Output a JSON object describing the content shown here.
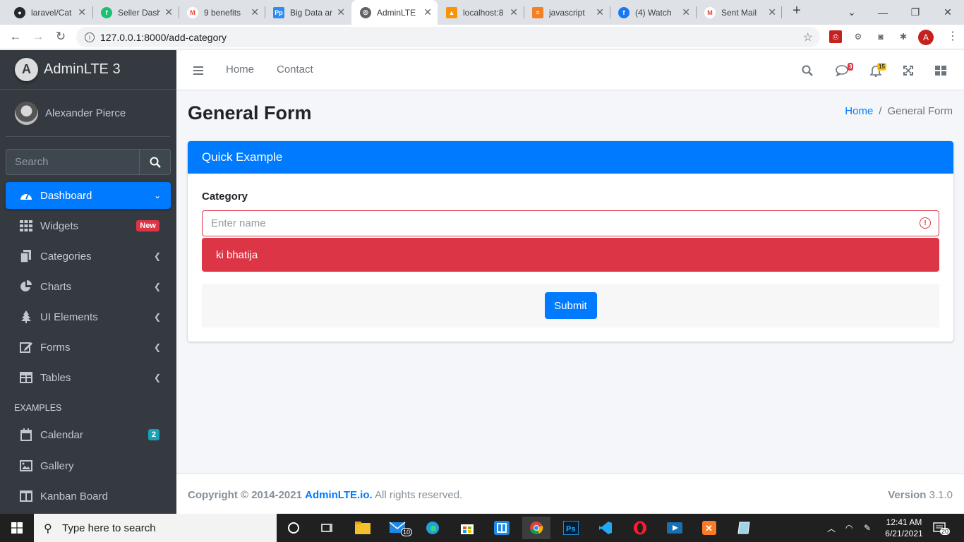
{
  "browser": {
    "tabs": [
      {
        "title": "laravel/Cat",
        "icon": "github-icon",
        "color": "#24292e"
      },
      {
        "title": "Seller Dash",
        "icon": "fiverr-icon",
        "color": "#1dbf73"
      },
      {
        "title": "9 benefits",
        "icon": "gmail-icon",
        "color": "#ea4335"
      },
      {
        "title": "Big Data ar",
        "icon": "pp-icon",
        "color": "#2d8cf0"
      },
      {
        "title": "AdminLTE",
        "icon": "globe-icon",
        "color": "#5f6368"
      },
      {
        "title": "localhost:8",
        "icon": "phpmyadmin-icon",
        "color": "#f89406"
      },
      {
        "title": "javascript",
        "icon": "stackoverflow-icon",
        "color": "#f48024"
      },
      {
        "title": "(4) Watch",
        "icon": "facebook-icon",
        "color": "#1877f2"
      },
      {
        "title": "Sent Mail",
        "icon": "gmail-icon",
        "color": "#ea4335"
      }
    ],
    "url": "127.0.0.1:8000/add-category",
    "profile_initial": "A"
  },
  "sidebar": {
    "brand": "AdminLTE 3",
    "brand_logo": "A",
    "user": "Alexander Pierce",
    "search_placeholder": "Search",
    "items": [
      {
        "label": "Dashboard",
        "icon": "dashboard-icon"
      },
      {
        "label": "Widgets",
        "icon": "widgets-icon",
        "badge": "New"
      },
      {
        "label": "Categories",
        "icon": "copy-icon"
      },
      {
        "label": "Charts",
        "icon": "chart-pie-icon"
      },
      {
        "label": "UI Elements",
        "icon": "tree-icon"
      },
      {
        "label": "Forms",
        "icon": "edit-icon"
      },
      {
        "label": "Tables",
        "icon": "table-icon"
      }
    ],
    "examples_header": "EXAMPLES",
    "examples": [
      {
        "label": "Calendar",
        "icon": "calendar-icon",
        "badge": "2"
      },
      {
        "label": "Gallery",
        "icon": "image-icon"
      },
      {
        "label": "Kanban Board",
        "icon": "columns-icon"
      }
    ]
  },
  "header": {
    "links": [
      "Home",
      "Contact"
    ],
    "messages_count": "3",
    "notifications_count": "15"
  },
  "page": {
    "title": "General Form",
    "breadcrumb": [
      "Home",
      "/",
      "General Form"
    ]
  },
  "card": {
    "title": "Quick Example",
    "label": "Category",
    "placeholder": "Enter name",
    "error": "ki bhatija",
    "submit": "Submit"
  },
  "footer": {
    "copyright": "Copyright © 2014-2021",
    "site": "AdminLTE.io.",
    "rights": "All rights reserved.",
    "version_label": "Version",
    "version": "3.1.0"
  },
  "taskbar": {
    "search_placeholder": "Type here to search",
    "time": "12:41 AM",
    "date": "6/21/2021",
    "mail_badge": "10",
    "notifications": "20"
  },
  "colors": {
    "primary": "#007bff",
    "danger": "#dc3545",
    "sidebar": "#343a40"
  }
}
